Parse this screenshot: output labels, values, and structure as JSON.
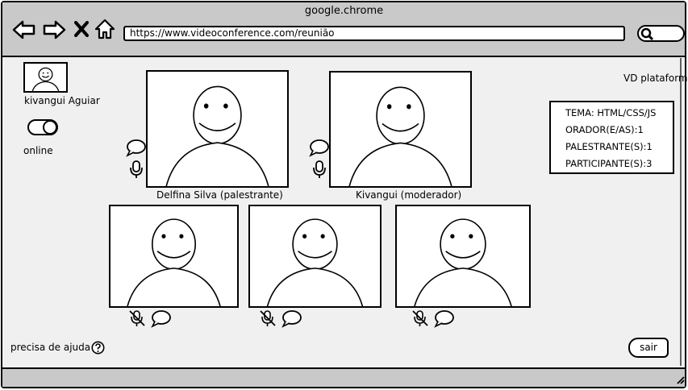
{
  "browser": {
    "title": "google.chrome",
    "url": "https://www.videoconference.com/reunião",
    "nav_icons": [
      "back-arrow-icon",
      "forward-arrow-icon",
      "close-x-icon",
      "home-icon"
    ],
    "search_icon": "search-icon"
  },
  "user": {
    "name": "kivangui Aguiar",
    "status": "online",
    "avatar_icon": "smiley-avatar-icon"
  },
  "platform_label": "VD plataform",
  "info_panel": {
    "lines": [
      "TEMA: HTML/CSS/JS",
      "ORADOR(E/AS):1",
      "PALESTRANTE(S):1",
      "PARTICIPANTE(S):3"
    ]
  },
  "participants": {
    "speaker": {
      "name": "Delfina Silva (palestrante)",
      "mic": "on"
    },
    "moderator": {
      "name": "Kivangui (moderador)",
      "mic": "on"
    },
    "others": [
      {
        "mic": "muted"
      },
      {
        "mic": "muted"
      },
      {
        "mic": "muted"
      }
    ]
  },
  "help": {
    "label": "precisa de ajuda",
    "icon": "question-icon"
  },
  "exit": {
    "label": "sair"
  }
}
